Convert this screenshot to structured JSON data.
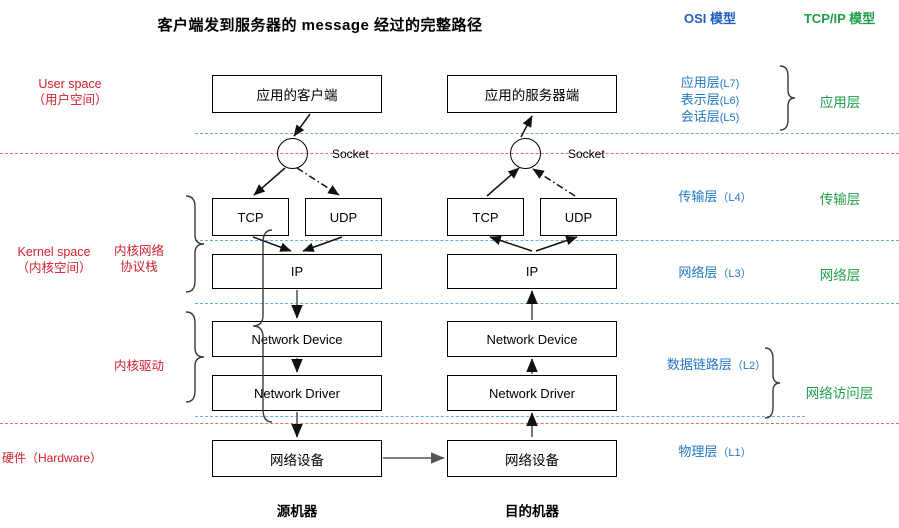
{
  "title": "客户端发到服务器的  message  经过的完整路径",
  "columns": {
    "osi_heading": "OSI 模型",
    "tcpip_heading": "TCP/IP 模型"
  },
  "colors": {
    "osi": "#2378c4",
    "tcpip": "#1e9e4a",
    "annotation_red": "#d02030",
    "sep_blue": "#6fa8dc",
    "sep_red": "#e06c75",
    "box_border": "#000000"
  },
  "left_annotations": {
    "user_space_en": "User space",
    "user_space_cn": "（用户空间）",
    "kernel_space_en": "Kernel space",
    "kernel_space_cn": "（内核空间）",
    "kernel_net_stack": "内核网络",
    "kernel_net_stack2": "协议栈",
    "kernel_driver": "内核驱动",
    "hardware": "硬件（Hardware）"
  },
  "osi_layers": [
    {
      "name": "应用层",
      "level": "(L7)"
    },
    {
      "name": "表示层",
      "level": "(L6)"
    },
    {
      "name": "会话层",
      "level": "(L5)"
    },
    {
      "name": "传输层",
      "level": "（L4）"
    },
    {
      "name": "网络层",
      "level": "（L3）"
    },
    {
      "name": "数据链路层",
      "level": "（L2）"
    },
    {
      "name": "物理层",
      "level": "（L1）"
    }
  ],
  "tcpip_layers": [
    {
      "name": "应用层"
    },
    {
      "name": "传输层"
    },
    {
      "name": "网络层"
    },
    {
      "name": "网络访问层"
    }
  ],
  "source_machine": {
    "caption": "源机器",
    "app": "应用的客户端",
    "socket": "Socket",
    "tcp": "TCP",
    "udp": "UDP",
    "ip": "IP",
    "net_device": "Network Device",
    "net_driver": "Network Driver",
    "hw_device": "网络设备"
  },
  "dest_machine": {
    "caption": "目的机器",
    "app": "应用的服务器端",
    "socket": "Socket",
    "tcp": "TCP",
    "udp": "UDP",
    "ip": "IP",
    "net_device": "Network Device",
    "net_driver": "Network Driver",
    "hw_device": "网络设备"
  }
}
